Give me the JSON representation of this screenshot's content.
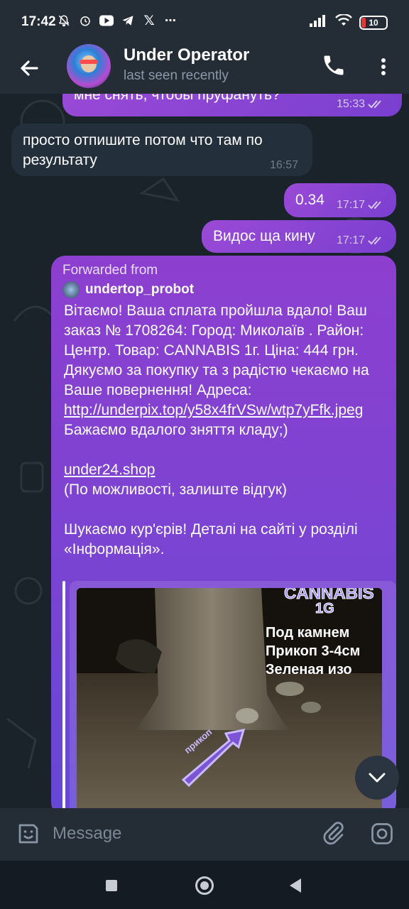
{
  "status_bar": {
    "time": "17:42",
    "battery": "10",
    "icons": [
      "mute-icon",
      "alarm-icon",
      "youtube-icon",
      "telegram-icon",
      "x-icon",
      "more-icon"
    ]
  },
  "header": {
    "title": "Under Operator",
    "subtitle": "last seen recently"
  },
  "messages": [
    {
      "text": "мне снять, чтобы пруфануть?",
      "time": "15:33",
      "direction": "out"
    },
    {
      "text": "просто отпишите потом что там по результату",
      "time": "16:57",
      "direction": "in"
    },
    {
      "text": "0.34",
      "time": "17:17",
      "direction": "out"
    },
    {
      "text": "Видос ща кину",
      "time": "17:17",
      "direction": "out"
    }
  ],
  "forward": {
    "label": "Forwarded from",
    "source": "undertop_probot",
    "line1": "Вітаємо! Ваша сплата пройшла вдало! Ваш заказ № 1708264: Город: Миколаїв . Район: Центр. Товар: CANNABIS 1г. Ціна: 444 грн. Дякуємо за покупку та з радістю чекаємо на Ваше повернення! Адреса: ",
    "link1": "http://underpix.top/y58x4frVSw/wtp7yFfk.jpeg",
    "line2": " Бажаємо вдалого зняття кладу;)",
    "link2": "under24.shop",
    "line3": "(По можливості, залиште відгук)",
    "line4": "Шукаємо кур'єрів! Деталі на сайті у розділі «Інформація».",
    "photo": {
      "title": "CANNABIS",
      "subtitle": "1G",
      "lines": [
        "Под камнем",
        "Прикоп 3-4см",
        "Зеленая изо"
      ],
      "arrow_label": "прикоп"
    }
  },
  "input": {
    "placeholder": "Message"
  }
}
